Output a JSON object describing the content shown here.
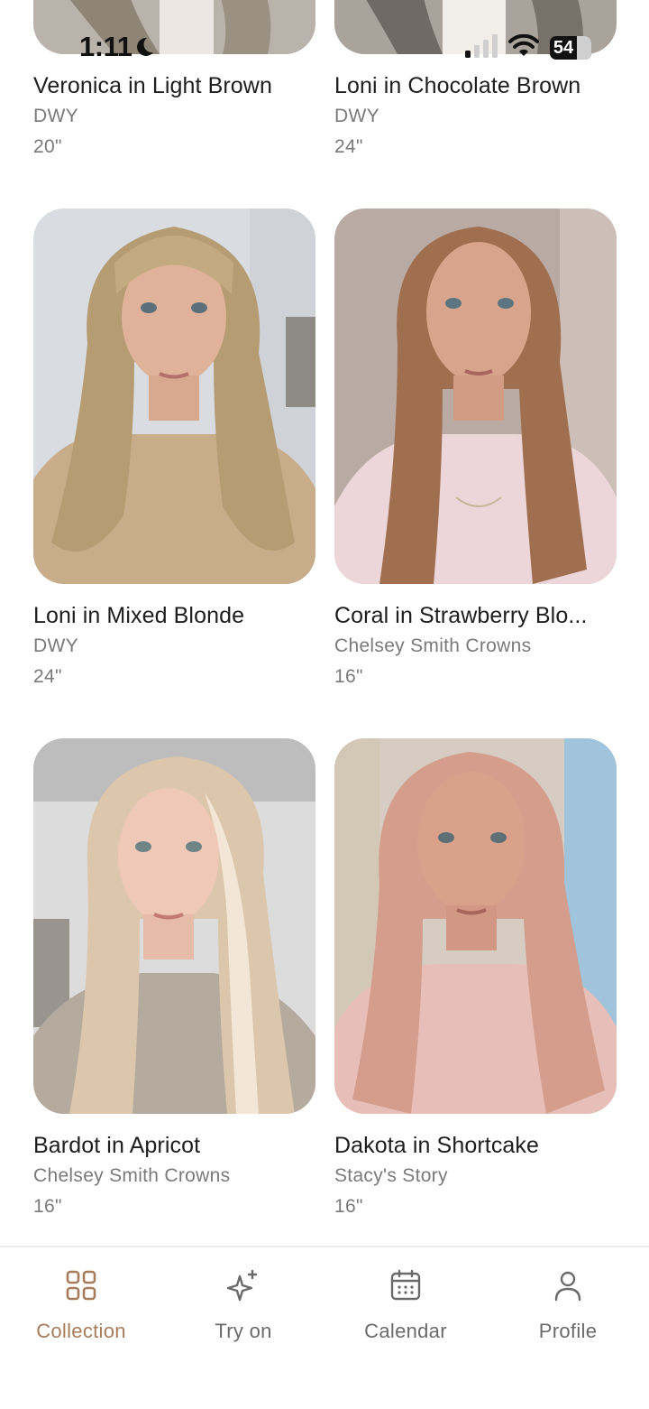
{
  "status_bar": {
    "time": "1:11",
    "battery": "54"
  },
  "products": [
    {
      "title": "Veronica in Light Brown",
      "brand": "DWY",
      "length": "20\""
    },
    {
      "title": "Loni in Chocolate Brown",
      "brand": "DWY",
      "length": "24\""
    },
    {
      "title": "Loni in Mixed Blonde",
      "brand": "DWY",
      "length": "24\""
    },
    {
      "title": "Coral in Strawberry Blo...",
      "brand": "Chelsey Smith Crowns",
      "length": "16\""
    },
    {
      "title": "Bardot in Apricot",
      "brand": "Chelsey Smith Crowns",
      "length": "16\""
    },
    {
      "title": "Dakota in Shortcake",
      "brand": "Stacy's Story",
      "length": "16\""
    }
  ],
  "nav": [
    {
      "label": "Collection",
      "icon": "grid-icon",
      "active": true
    },
    {
      "label": "Try on",
      "icon": "sparkles-icon",
      "active": false
    },
    {
      "label": "Calendar",
      "icon": "calendar-icon",
      "active": false
    },
    {
      "label": "Profile",
      "icon": "user-icon",
      "active": false
    }
  ],
  "colors": {
    "accent": "#a67c5b",
    "muted_text": "#7a7a7a",
    "nav_text": "#6a6a6a"
  }
}
